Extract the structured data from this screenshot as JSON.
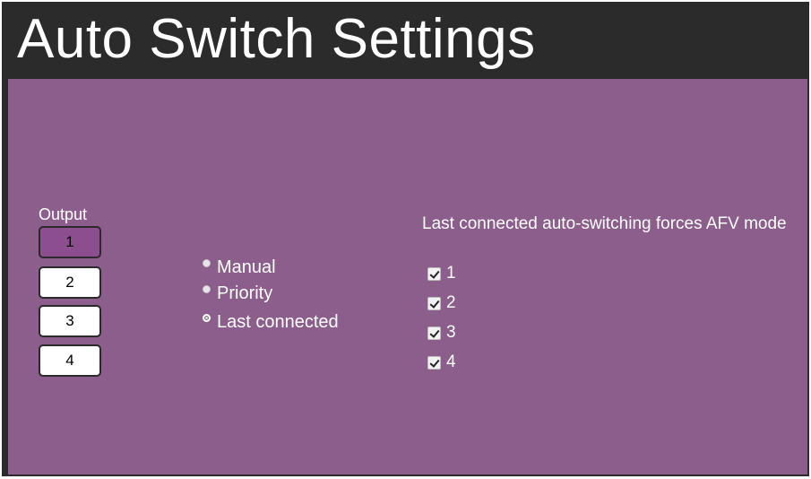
{
  "header": {
    "title": "Auto Switch Settings"
  },
  "output": {
    "label": "Output",
    "buttons": [
      "1",
      "2",
      "3",
      "4"
    ],
    "selected": "1"
  },
  "mode": {
    "options": [
      {
        "label": "Manual",
        "checked": false
      },
      {
        "label": "Priority",
        "checked": false
      },
      {
        "label": "Last connected",
        "checked": true
      }
    ]
  },
  "afv": {
    "heading": "Last connected auto-switching forces AFV mode",
    "items": [
      {
        "label": "1",
        "checked": true
      },
      {
        "label": "2",
        "checked": true
      },
      {
        "label": "3",
        "checked": true
      },
      {
        "label": "4",
        "checked": true
      }
    ]
  },
  "colors": {
    "panel": "#8c5e8b",
    "header": "#2b2b2b",
    "selected_button": "#8c4e8e"
  }
}
